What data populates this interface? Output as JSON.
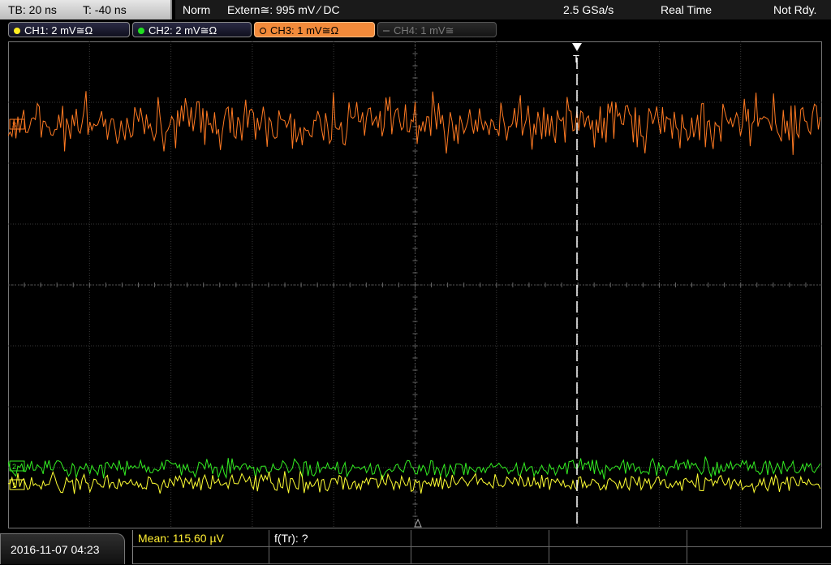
{
  "header": {
    "timebase": "TB: 20 ns",
    "trigger_time": "T: -40 ns",
    "mode": "Norm",
    "trigger_source": "Extern≅: 995 mV ∕ DC",
    "sample_rate": "2.5 GSa/s",
    "acquisition": "Real Time",
    "status": "Not Rdy."
  },
  "channels": [
    {
      "label": "CH1: 2 mV≅Ω",
      "color": "#ffee22",
      "state": "on"
    },
    {
      "label": "CH2: 2 mV≅Ω",
      "color": "#22dd22",
      "state": "on"
    },
    {
      "label": "CH3: 1 mV≅Ω",
      "color": "#ff8a30",
      "state": "active"
    },
    {
      "label": "CH4: 1 mV≅",
      "color": "#666666",
      "state": "off"
    }
  ],
  "screen": {
    "h_divisions": 10,
    "v_divisions": 8,
    "trigger_marker": "T",
    "traces": [
      {
        "channel": "CH3",
        "color": "#ff7a22"
      },
      {
        "channel": "CH2",
        "color": "#33ee22"
      },
      {
        "channel": "CH1",
        "color": "#ffff33"
      }
    ]
  },
  "footer": {
    "datetime": "2016-11-07 04:23",
    "measurements": [
      {
        "label": "Mean: 115.60 µV",
        "color": "#ffee33"
      },
      {
        "label": "f(Tr): ?",
        "color": "#ffffff"
      }
    ]
  }
}
